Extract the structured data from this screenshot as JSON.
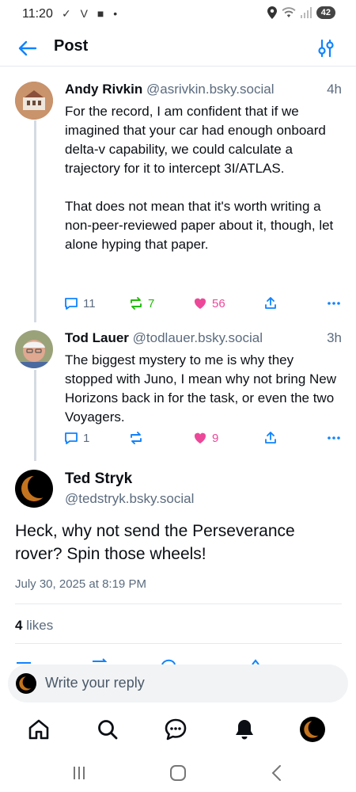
{
  "status_bar": {
    "time": "11:20",
    "left_icons": "✓ V ■ •",
    "battery": "42"
  },
  "header": {
    "title": "Post",
    "back_icon": "arrow-left-icon",
    "settings_icon": "sliders-icon"
  },
  "thread": [
    {
      "author_name": "Andy Rivkin",
      "author_handle": "@asrivkin.bsky.social",
      "time": "4h",
      "text": "For the record, I am confident that if we imagined that your car had enough onboard delta-v capability, we could calculate a trajectory for it to intercept 3I/ATLAS.\n\nThat does not mean that it's worth writing a non-peer-reviewed paper about it, though, let alone hyping that paper.",
      "replies": "11",
      "reposts": "7",
      "likes": "56"
    },
    {
      "author_name": "Tod Lauer",
      "author_handle": "@todlauer.bsky.social",
      "time": "3h",
      "text": "The biggest mystery to me is why they stopped with Juno, I mean why not bring New Horizons back in for the task, or even the two Voyagers.",
      "replies": "1",
      "reposts": "",
      "likes": "9"
    }
  ],
  "main_post": {
    "author_name": "Ted Stryk",
    "author_handle": "@tedstryk.bsky.social",
    "text": "Heck, why not send the Perseverance rover? Spin those wheels!",
    "date": "July 30, 2025 at 8:19 PM",
    "likes_count": "4",
    "likes_label": "likes"
  },
  "reply_bar": {
    "placeholder": "Write your reply"
  },
  "colors": {
    "accent": "#1083fe",
    "repost": "#20bc07",
    "like": "#ec4899",
    "muted": "#5b6b7e"
  },
  "bottom_nav": [
    "home-icon",
    "search-icon",
    "chat-icon",
    "bell-icon",
    "profile-avatar"
  ]
}
